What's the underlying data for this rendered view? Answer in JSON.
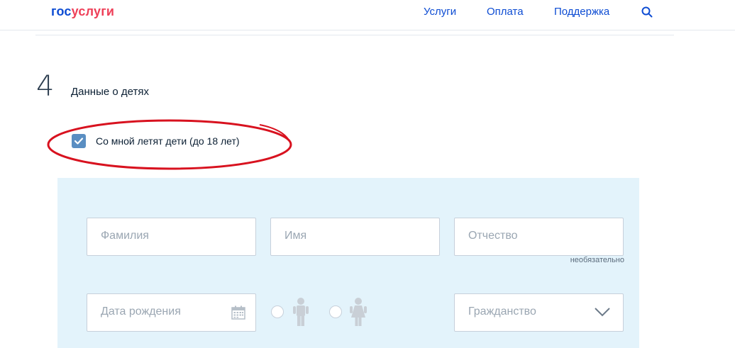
{
  "header": {
    "logo_part1": "гос",
    "logo_part2": "услуги",
    "nav": [
      "Услуги",
      "Оплата",
      "Поддержка"
    ]
  },
  "step": {
    "number": "4",
    "title": "Данные о детях"
  },
  "children_checkbox": {
    "label": "Со мной летят дети (до 18 лет)",
    "checked": true
  },
  "form": {
    "surname_placeholder": "Фамилия",
    "name_placeholder": "Имя",
    "patronymic_placeholder": "Отчество",
    "patronymic_note": "необязательно",
    "birthdate_placeholder": "Дата рождения",
    "citizenship_placeholder": "Гражданство"
  },
  "colors": {
    "brand_blue": "#0d4cd3",
    "brand_red": "#ee3f58",
    "panel_bg": "#e3f3fb",
    "checkbox_fill": "#5a8ec2",
    "annotation_ellipse": "#d8121f"
  },
  "icons": [
    "search-icon",
    "check-icon",
    "calendar-icon",
    "male-child-icon",
    "female-child-icon",
    "chevron-down-icon"
  ]
}
